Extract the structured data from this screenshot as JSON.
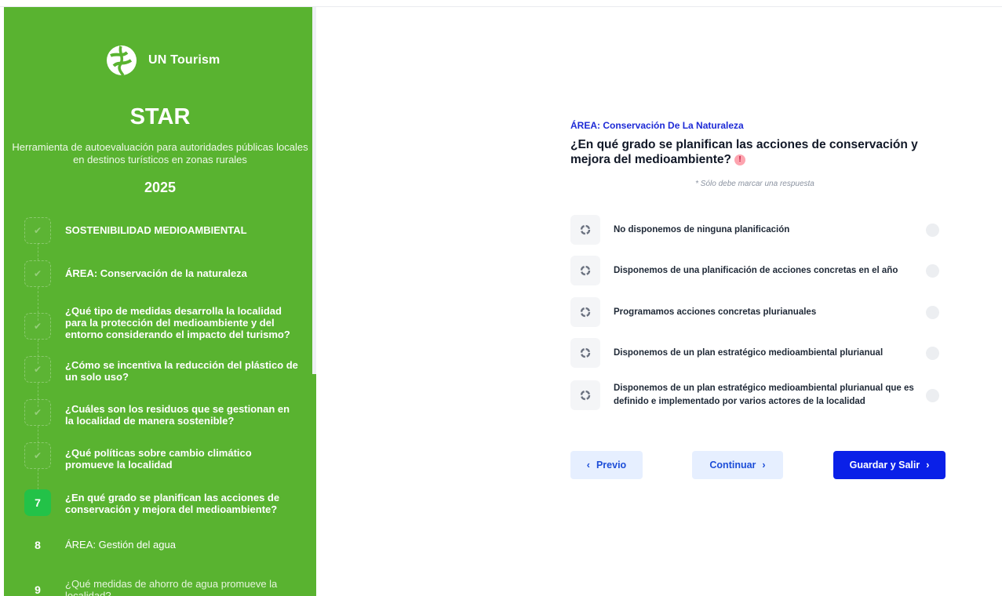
{
  "brand": {
    "logo_text": "UN Tourism"
  },
  "sidebar": {
    "title": "STAR",
    "subtitle": "Herramienta de autoevaluación para autoridades públicas locales en destinos turísticos en zonas rurales",
    "year": "2025",
    "steps": [
      {
        "label": "SOSTENIBILIDAD MEDIOAMBIENTAL",
        "state": "completed"
      },
      {
        "label": "ÁREA: Conservación de la naturaleza",
        "state": "completed"
      },
      {
        "label": "¿Qué tipo de medidas desarrolla la localidad para la protección del medioambiente y del entorno considerando el impacto del turismo?",
        "state": "completed"
      },
      {
        "label": "¿Cómo se incentiva la reducción del plástico de un solo uso?",
        "state": "completed"
      },
      {
        "label": "¿Cuáles son los residuos que se gestionan en la localidad de manera sostenible?",
        "state": "completed"
      },
      {
        "label": "¿Qué políticas sobre cambio climático promueve la localidad",
        "state": "completed"
      },
      {
        "number": "7",
        "label": "¿En qué grado se planifican las acciones de conservación y mejora del medioambiente?",
        "state": "active"
      },
      {
        "number": "8",
        "label": "ÁREA: Gestión del agua",
        "state": "todo"
      },
      {
        "number": "9",
        "label": "¿Qué medidas de ahorro de agua promueve la localidad?",
        "state": "todo"
      }
    ]
  },
  "main": {
    "area_label": "ÁREA: Conservación De La Naturaleza",
    "question": "¿En qué grado se planifican las acciones de conservación y mejora del medioambiente?",
    "hint": "* Sólo debe marcar una respuesta",
    "options": [
      {
        "label": "No disponemos de ninguna planificación"
      },
      {
        "label": "Disponemos de una planificación de acciones concretas en el año"
      },
      {
        "label": "Programamos acciones concretas plurianuales"
      },
      {
        "label": "Disponemos de un plan estratégico medioambiental plurianual"
      },
      {
        "label": "Disponemos de un plan estratégico medioambiental plurianual que es definido e implementado por varios actores de la localidad"
      }
    ]
  },
  "buttons": {
    "prev": "Previo",
    "next": "Continuar",
    "save": "Guardar y Salir"
  },
  "colors": {
    "sidebar_bg": "#59b330",
    "active_step": "#23c248",
    "primary": "#0a20e8",
    "area_label": "#1d2ad6",
    "warning": "#fda4af"
  },
  "icons": {
    "option": "spinner-icon",
    "warning": "exclamation-icon",
    "check": "check-icon",
    "prev": "chevron-left-icon",
    "next": "chevron-right-icon"
  }
}
